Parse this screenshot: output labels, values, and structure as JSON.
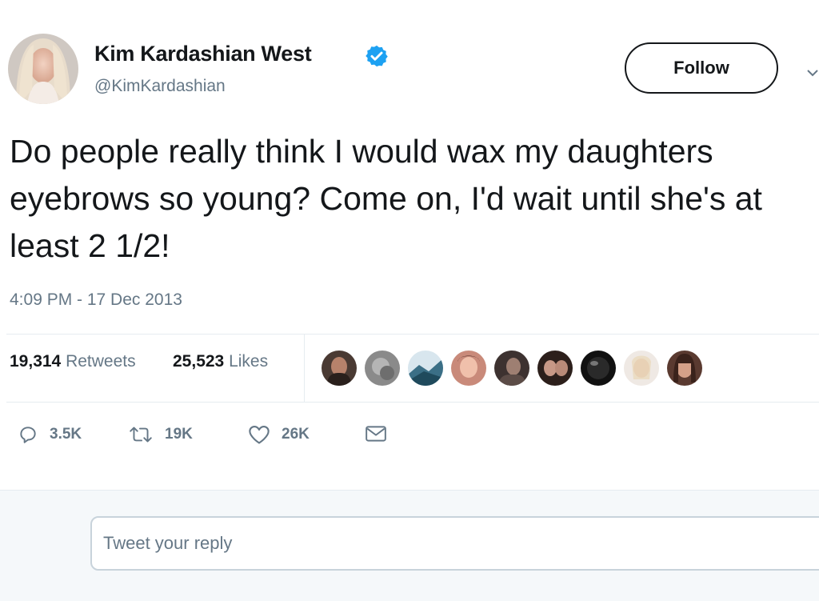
{
  "author": {
    "display_name": "Kim Kardashian West",
    "handle": "@KimKardashian",
    "verified": true
  },
  "follow_button": {
    "label": "Follow"
  },
  "tweet": {
    "text": "Do people really think I would wax my daughters eyebrows so young?  Come on, I'd wait until she's at least 2 1/2!",
    "timestamp": "4:09 PM - 17 Dec 2013"
  },
  "stats": {
    "retweets_count": "19,314",
    "retweets_label": "Retweets",
    "likes_count": "25,523",
    "likes_label": "Likes"
  },
  "liker_avatars": [
    "liker-1",
    "liker-2",
    "liker-3",
    "liker-4",
    "liker-5",
    "liker-6",
    "liker-7",
    "liker-8",
    "liker-9"
  ],
  "actions": {
    "reply": {
      "icon": "reply-icon",
      "count": "3.5K"
    },
    "retweet": {
      "icon": "retweet-icon",
      "count": "19K"
    },
    "like": {
      "icon": "heart-icon",
      "count": "26K"
    },
    "message": {
      "icon": "envelope-icon"
    }
  },
  "reply_box": {
    "placeholder": "Tweet your reply"
  },
  "colors": {
    "primary_text": "#14171a",
    "secondary_text": "#657786",
    "verified_blue": "#1da1f2",
    "divider": "#e6ecf0",
    "reply_background": "#f5f8fa"
  }
}
